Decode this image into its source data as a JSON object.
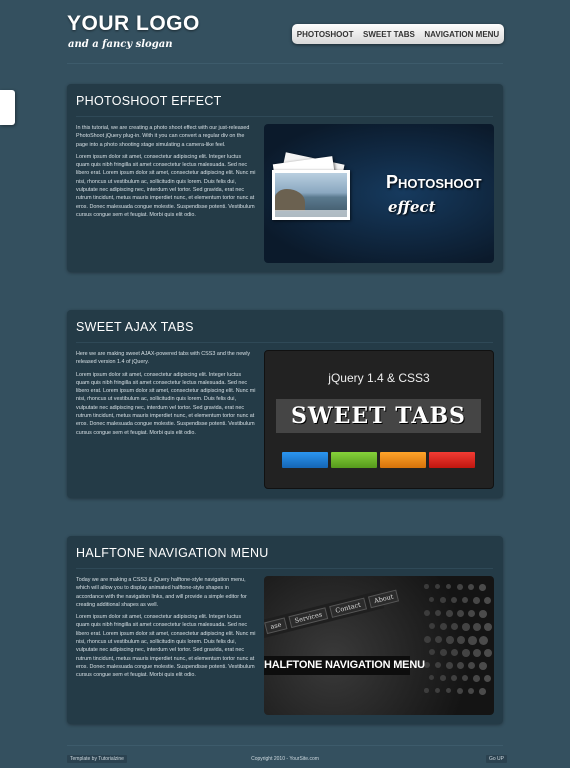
{
  "header": {
    "logo": "YOUR LOGO",
    "slogan": "and a fancy slogan",
    "nav": [
      "PHOTOSHOOT",
      "SWEET TABS",
      "NAVIGATION MENU"
    ]
  },
  "sections": [
    {
      "title": "PHOTOSHOOT EFFECT",
      "intro": "In this tutorial, we are creating a photo shoot effect with our just-released PhotoShoot jQuery plug-in. With it you can convert a regular div on the page into a photo shooting stage simulating a camera-like feel.",
      "body": "Lorem ipsum dolor sit amet, consectetur adipiscing elit. Integer luctus quam quis nibh fringilla sit amet consectetur lectus malesuada. Sed nec libero erat. Lorem ipsum dolor sit amet, consectetur adipiscing elit. Nunc mi nisi, rhoncus ut vestibulum ac, sollicitudin quis lorem. Duis felis dui, vulputate nec adipiscing nec, interdum vel tortor. Sed gravida, erat nec rutrum tincidunt, metus mauris imperdiet nunc, et elementum tortor nunc at eros. Donec malesuada congue molestie. Suspendisse potenti. Vestibulum cursus congue sem et feugiat. Morbi quis elit odio.",
      "image_title": "Photoshoot",
      "image_subtitle": "effect"
    },
    {
      "title": "SWEET AJAX TABS",
      "intro": "Here we are making sweet AJAX-powered tabs with CSS3 and the newly released version 1.4 of jQuery.",
      "body": "Lorem ipsum dolor sit amet, consectetur adipiscing elit. Integer luctus quam quis nibh fringilla sit amet consectetur lectus malesuada. Sed nec libero erat. Lorem ipsum dolor sit amet, consectetur adipiscing elit. Nunc mi nisi, rhoncus ut vestibulum ac, sollicitudin quis lorem. Duis felis dui, vulputate nec adipiscing nec, interdum vel tortor. Sed gravida, erat nec rutrum tincidunt, metus mauris imperdiet nunc, et elementum tortor nunc at eros. Donec malesuada congue molestie. Suspendisse potenti. Vestibulum cursus congue sem et feugiat. Morbi quis elit odio.",
      "image_caption": "jQuery 1.4 & CSS3",
      "image_title": "SWEET TABS",
      "tab_colors": [
        "#1e7fd6",
        "#6fb92c",
        "#f08c12",
        "#e0261f"
      ]
    },
    {
      "title": "HALFTONE NAVIGATION MENU",
      "intro": "Today we are making a CSS3 & jQuery halftone-style navigation menu, which will allow you to display animated halftone-style shapes in accordance with the navigation links, and will provide a simple editor for creating additional shapes as well.",
      "body": "Lorem ipsum dolor sit amet, consectetur adipiscing elit. Integer luctus quam quis nibh fringilla sit amet consectetur lectus malesuada. Sed nec libero erat. Lorem ipsum dolor sit amet, consectetur adipiscing elit. Nunc mi nisi, rhoncus ut vestibulum ac, sollicitudin quis lorem. Duis felis dui, vulputate nec adipiscing nec, interdum vel tortor. Sed gravida, erat nec rutrum tincidunt, metus mauris imperdiet nunc, et elementum tortor nunc at eros. Donec malesuada congue molestie. Suspendisse potenti. Vestibulum cursus congue sem et feugiat. Morbi quis elit odio.",
      "image_title": "HALFTONE NAVIGATION MENU",
      "image_nav": [
        "ase",
        "Services",
        "Contact",
        "About"
      ]
    }
  ],
  "footer": {
    "left": "Template by Tutorialzine",
    "center": "Copyright 2010 - YourSite.com",
    "right": "Go UP"
  }
}
